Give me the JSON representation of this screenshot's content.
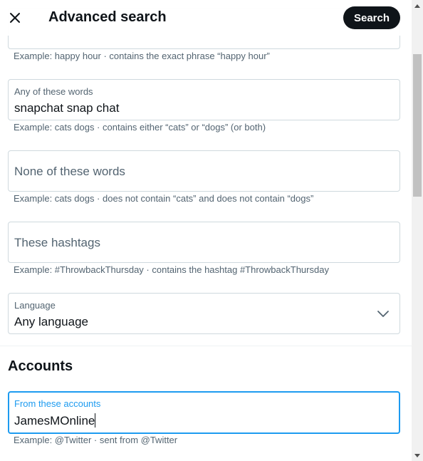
{
  "header": {
    "title": "Advanced search",
    "search_label": "Search"
  },
  "fields": {
    "exact_phrase": {
      "hint": "Example: happy hour · contains the exact phrase “happy hour”"
    },
    "any_words": {
      "label": "Any of these words",
      "value": "snapchat snap chat",
      "hint": "Example: cats dogs · contains either “cats” or “dogs” (or both)"
    },
    "none_words": {
      "placeholder": "None of these words",
      "hint": "Example: cats dogs · does not contain “cats” and does not contain “dogs”"
    },
    "hashtags": {
      "placeholder": "These hashtags",
      "hint": "Example: #ThrowbackThursday · contains the hashtag #ThrowbackThursday"
    },
    "language": {
      "label": "Language",
      "value": "Any language"
    }
  },
  "accounts": {
    "section_title": "Accounts",
    "from": {
      "label": "From these accounts",
      "value": "JamesMOnline",
      "hint": "Example: @Twitter · sent from @Twitter"
    }
  },
  "colors": {
    "accent": "#1d9bf0",
    "primary_button": "#0f1419",
    "secondary_text": "#536471",
    "border": "#cfd9de"
  }
}
